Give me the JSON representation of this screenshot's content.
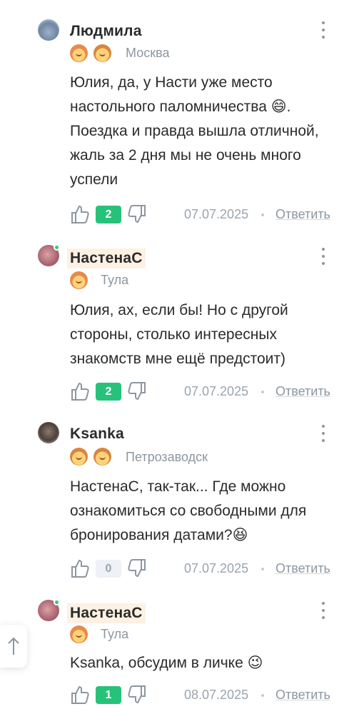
{
  "comments": [
    {
      "username": "Людмила",
      "city": "Москва",
      "text": "Юлия, да, у Насти уже место настольного паломничества 😄. Поездка и правда вышла отличной, жаль за 2 дня мы не очень много успели",
      "likes": "2",
      "date": "07.07.2025",
      "reply_label": "Ответить"
    },
    {
      "username": "НастенаС",
      "city": "Тула",
      "text": "Юлия, ах, если бы! Но с другой стороны, столько интересных знакомств мне ещё предстоит)",
      "likes": "2",
      "date": "07.07.2025",
      "reply_label": "Ответить"
    },
    {
      "username": "Ksanka",
      "city": "Петрозаводск",
      "text": "НастенаС, так-так... Где можно ознакомиться со свободными для бронирования датами?😆",
      "likes": "0",
      "date": "07.07.2025",
      "reply_label": "Ответить"
    },
    {
      "username": "НастенаС",
      "city": "Тула",
      "text": "Ksanka, обсудим в личке 😉",
      "likes": "1",
      "date": "08.07.2025",
      "reply_label": "Ответить"
    }
  ],
  "colors": {
    "like_badge": "#27c27a",
    "zero_badge": "#eef2f6",
    "online": "#2ecc71",
    "highlight": "#fdf1e3"
  },
  "icons": [
    "thumb-up-icon",
    "thumb-down-icon",
    "more-vertical-icon",
    "arrow-up-icon"
  ]
}
